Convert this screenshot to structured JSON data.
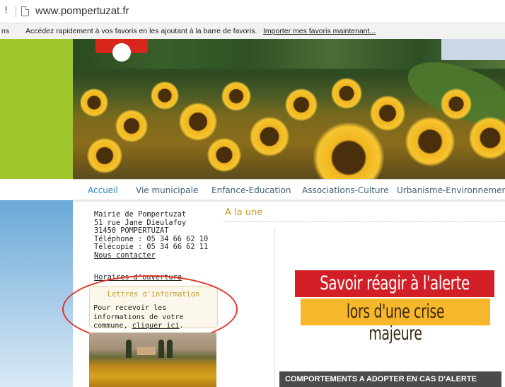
{
  "browser": {
    "address_fragment": "!",
    "url": "www.pompertuzat.fr"
  },
  "favorites_bar": {
    "cut_text": "ns",
    "message": "Accédez rapidement à vos favoris en les ajoutant à la barre de favoris.",
    "import_link": "Importer mes favoris maintenant..."
  },
  "nav": {
    "items": [
      {
        "label": "Accueil",
        "active": true
      },
      {
        "label": "Vie municipale",
        "active": false
      },
      {
        "label": "Enfance-Education",
        "active": false
      },
      {
        "label": "Associations-Culture",
        "active": false
      },
      {
        "label": "Urbanisme-Environnement",
        "active": false
      }
    ]
  },
  "contact": {
    "name": "Mairie de Pompertuzat",
    "street": "51 rue Jane Dieulafoy",
    "city": "31450 POMPERTUZAT",
    "phone": "Téléphone : 05 34 66 62 10",
    "fax": "Télécopie :  05 34 66 62 11",
    "contact_link": "Nous contacter",
    "hours_link": "Horaires d'ouverture"
  },
  "newsletter": {
    "title": "Lettres d'information",
    "text_before": "Pour recevoir les informations de votre commune, ",
    "link": "cliquer ici",
    "text_after": "."
  },
  "main": {
    "section_title": "A la une",
    "card": {
      "line1": "Savoir réagir à l'alerte",
      "line2": "lors d'une crise majeure",
      "caption": "COMPORTEMENTS A ADOPTER EN CAS D'ALERTE"
    }
  },
  "colors": {
    "accent_green": "#9fc52d",
    "nav_active": "#2a83c6",
    "title_gold": "#c79b2e",
    "alert_red": "#d21f27",
    "alert_yellow": "#f7b72a",
    "annotation_red": "#e23327"
  }
}
